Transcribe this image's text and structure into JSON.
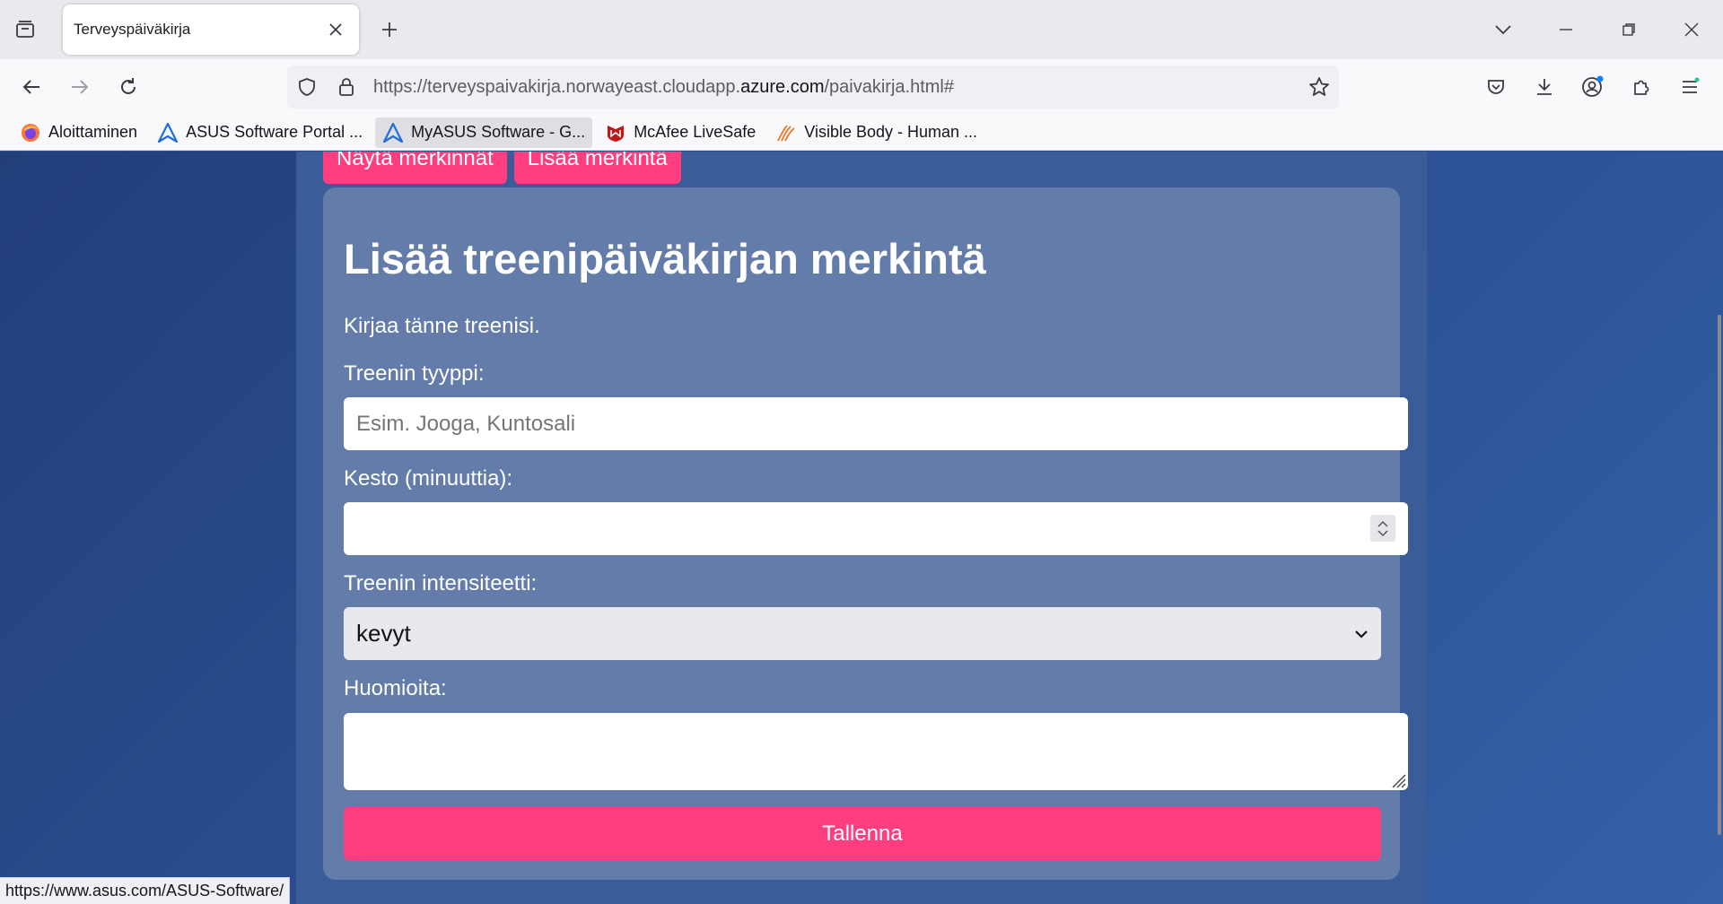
{
  "browser": {
    "tab": {
      "title": "Terveyspäiväkirja"
    },
    "url": {
      "prefix": "https://terveyspaivakirja.norwayeast.cloudapp.",
      "domain": "azure.com",
      "path": "/paivakirja.html#"
    },
    "bookmarks": [
      {
        "label": "Aloittaminen",
        "icon": "firefox-icon",
        "color": "#ff7139"
      },
      {
        "label": "ASUS Software Portal ...",
        "icon": "asus-icon",
        "color": "#1e6fd9"
      },
      {
        "label": "MyASUS Software - G...",
        "icon": "asus-icon",
        "color": "#1e6fd9"
      },
      {
        "label": "McAfee LiveSafe",
        "icon": "mcafee-icon",
        "color": "#c01818"
      },
      {
        "label": "Visible Body - Human ...",
        "icon": "visible-body-icon",
        "color": "#e8762b"
      }
    ],
    "status_url": "https://www.asus.com/ASUS-Software/"
  },
  "page": {
    "top_buttons": {
      "show": "Näytä merkinnät",
      "add": "Lisää merkintä"
    },
    "title": "Lisää treenipäiväkirjan merkintä",
    "description": "Kirjaa tänne treenisi.",
    "form": {
      "type_label": "Treenin tyyppi:",
      "type_placeholder": "Esim. Jooga, Kuntosali",
      "duration_label": "Kesto (minuuttia):",
      "duration_value": "",
      "intensity_label": "Treenin intensiteetti:",
      "intensity_value": "kevyt",
      "notes_label": "Huomioita:",
      "notes_value": "",
      "save_label": "Tallenna"
    }
  },
  "colors": {
    "accent": "#ff3d80",
    "card": "#637ca9",
    "background": "#2b4f8f"
  }
}
